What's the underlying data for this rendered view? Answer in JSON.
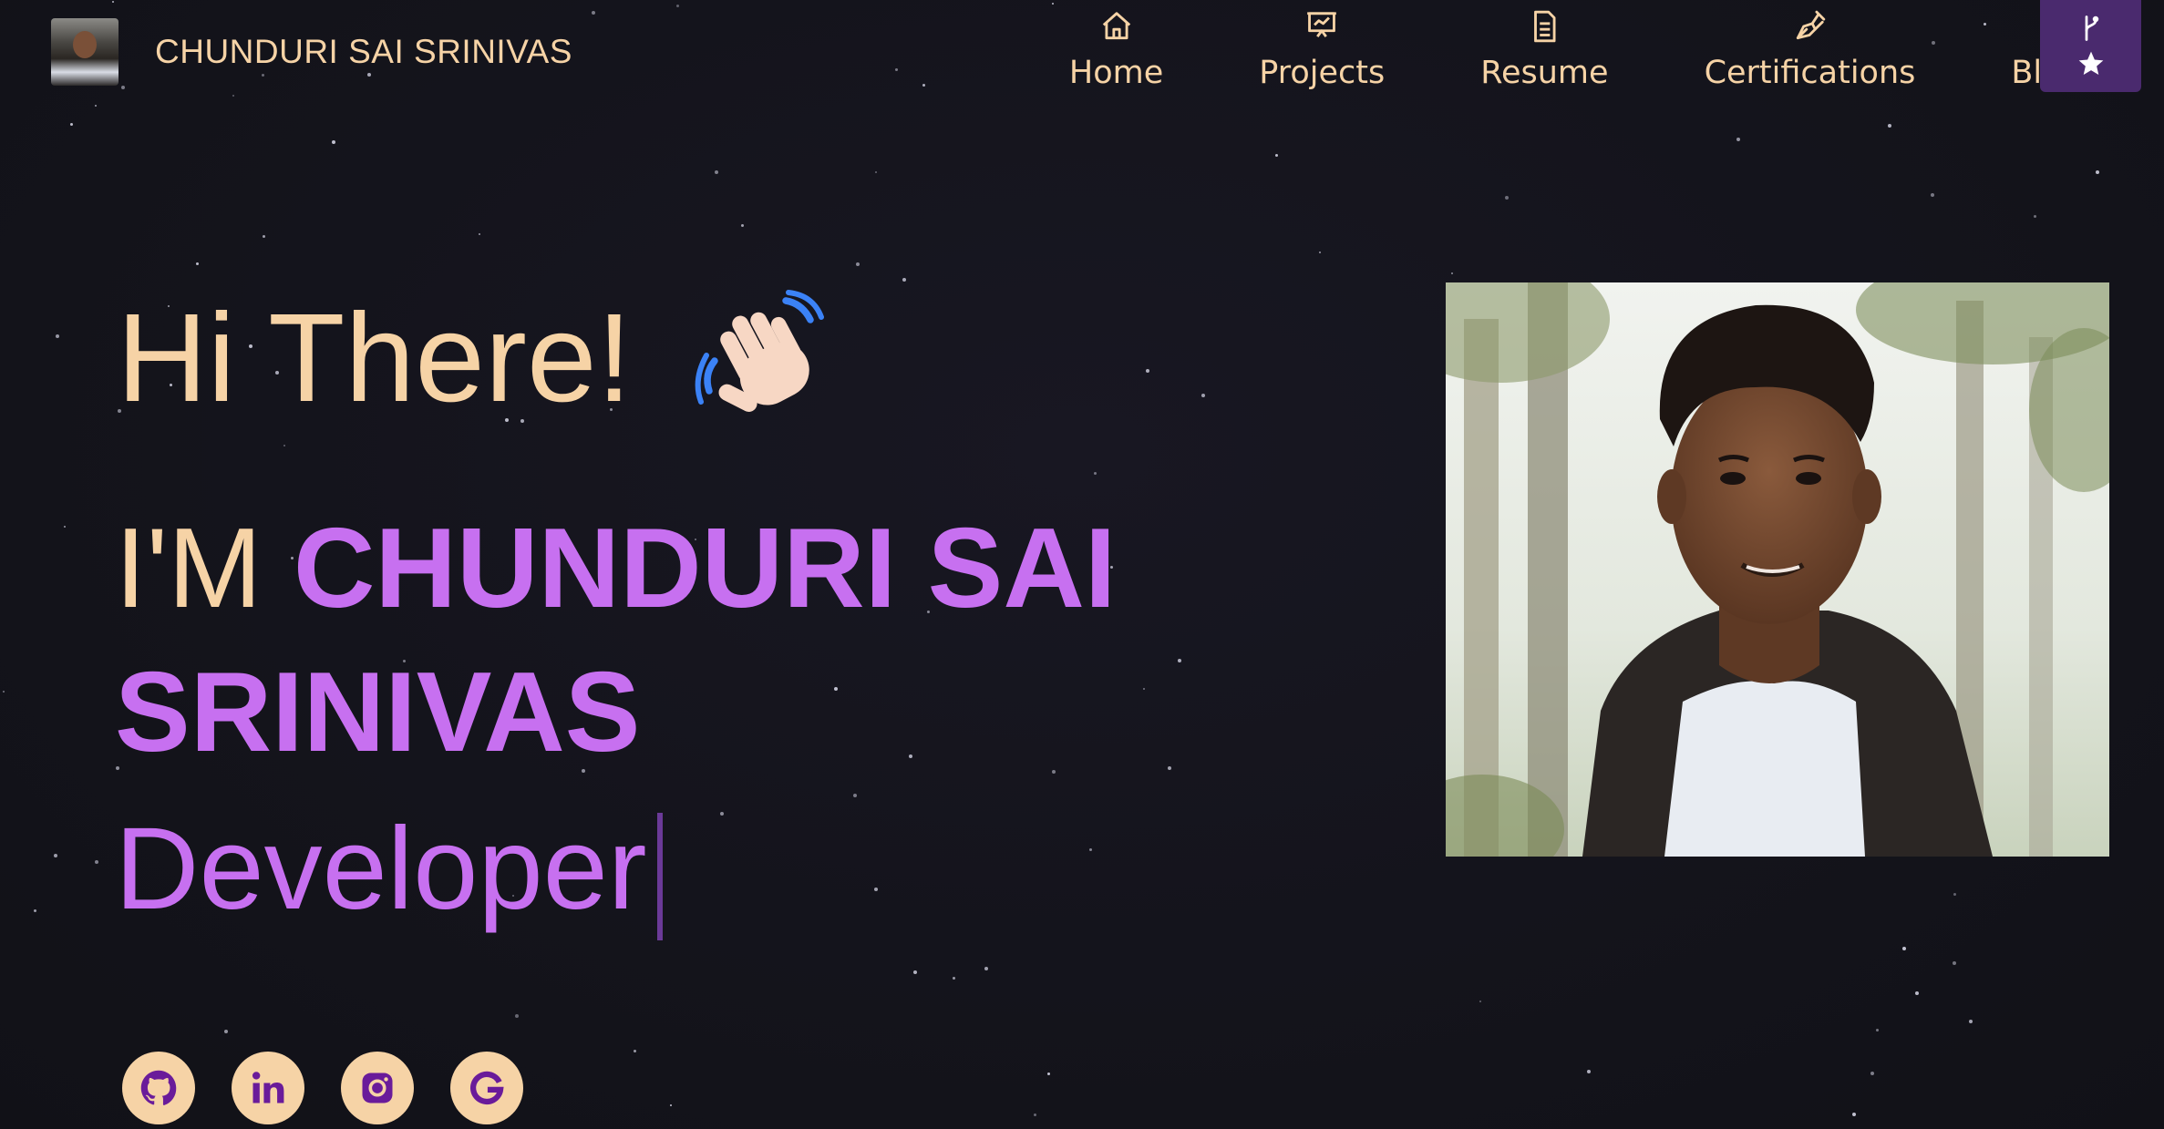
{
  "brand": {
    "name": "CHUNDURI SAI SRINIVAS"
  },
  "nav": {
    "items": [
      {
        "label": "Home",
        "icon": "home-icon"
      },
      {
        "label": "Projects",
        "icon": "presentation-icon"
      },
      {
        "label": "Resume",
        "icon": "document-icon"
      },
      {
        "label": "Certifications",
        "icon": "pen-nib-icon"
      },
      {
        "label": "Blogs",
        "icon": "blog-icon"
      }
    ],
    "fork_button": {
      "icons": [
        "git-fork-icon",
        "star-icon"
      ]
    }
  },
  "hero": {
    "greeting": "Hi There!",
    "greeting_emoji": "waving-hand-icon",
    "name_prefix": "I'M ",
    "name": "CHUNDURI SAI SRINIVAS",
    "typed_text": "Developer"
  },
  "social": [
    {
      "icon": "github-icon"
    },
    {
      "icon": "linkedin-icon"
    },
    {
      "icon": "instagram-icon"
    },
    {
      "icon": "google-icon"
    }
  ],
  "colors": {
    "background": "#14141c",
    "accent_purple": "#c770f0",
    "text_peach": "#f6d3a6",
    "button_purple": "#4a2a6e",
    "icon_dark_purple": "#6a1b9a"
  }
}
